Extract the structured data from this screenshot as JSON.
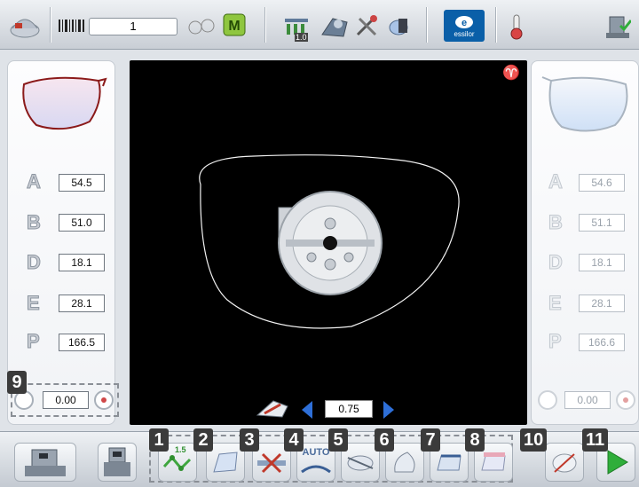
{
  "toolbar": {
    "job_number": "1",
    "brand_label": "essilor",
    "step_small_label": "1.0"
  },
  "left_panel": {
    "rows": [
      {
        "letter": "A",
        "value": "54.5"
      },
      {
        "letter": "B",
        "value": "51.0"
      },
      {
        "letter": "D",
        "value": "18.1"
      },
      {
        "letter": "E",
        "value": "28.1"
      },
      {
        "letter": "P",
        "value": "166.5"
      }
    ],
    "axis_value": "0.00"
  },
  "right_panel": {
    "rows": [
      {
        "letter": "A",
        "value": "54.6"
      },
      {
        "letter": "B",
        "value": "51.1"
      },
      {
        "letter": "D",
        "value": "18.1"
      },
      {
        "letter": "E",
        "value": "28.1"
      },
      {
        "letter": "P",
        "value": "166.6"
      }
    ],
    "axis_value": "0.00"
  },
  "canvas": {
    "step_value": "0.75"
  },
  "bottom": {
    "badges": [
      "1",
      "2",
      "3",
      "4",
      "5",
      "6",
      "7",
      "8",
      "9",
      "10",
      "11"
    ],
    "auto_label": "AUTO",
    "bevel_label": "1.5"
  },
  "colors": {
    "left_frame": "#8b1a1a",
    "canvas_bg": "#000000",
    "arrow_blue": "#2e6fd8",
    "go_green": "#2fae3a"
  }
}
